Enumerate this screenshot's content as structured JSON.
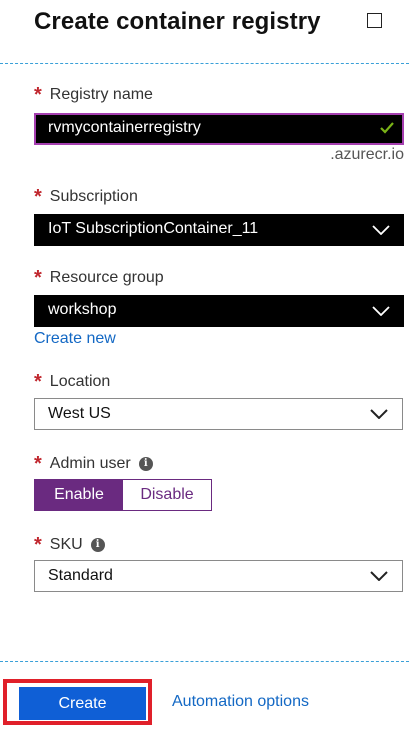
{
  "header": {
    "title": "Create container registry"
  },
  "fields": {
    "registry_name": {
      "label": "Registry name",
      "value": "rvmycontainerregistry",
      "suffix": ".azurecr.io"
    },
    "subscription": {
      "label": "Subscription",
      "value": "IoT SubscriptionContainer_11"
    },
    "resource_group": {
      "label": "Resource group",
      "value": "workshop",
      "create_new": "Create new"
    },
    "location": {
      "label": "Location",
      "value": "West US"
    },
    "admin_user": {
      "label": "Admin user",
      "enable": "Enable",
      "disable": "Disable",
      "selected": "Enable"
    },
    "sku": {
      "label": "SKU",
      "value": "Standard"
    }
  },
  "footer": {
    "create_label": "Create",
    "automation_label": "Automation options"
  },
  "colors": {
    "required": "#c0262d",
    "accent": "#6a2a80",
    "link": "#1368c4",
    "primary_button": "#0f5fd6",
    "highlight_outline": "#e0202a"
  },
  "icons": {
    "maximize": "maximize-icon",
    "valid": "checkmark-icon",
    "dropdown": "chevron-down-icon",
    "info": "info-icon"
  }
}
